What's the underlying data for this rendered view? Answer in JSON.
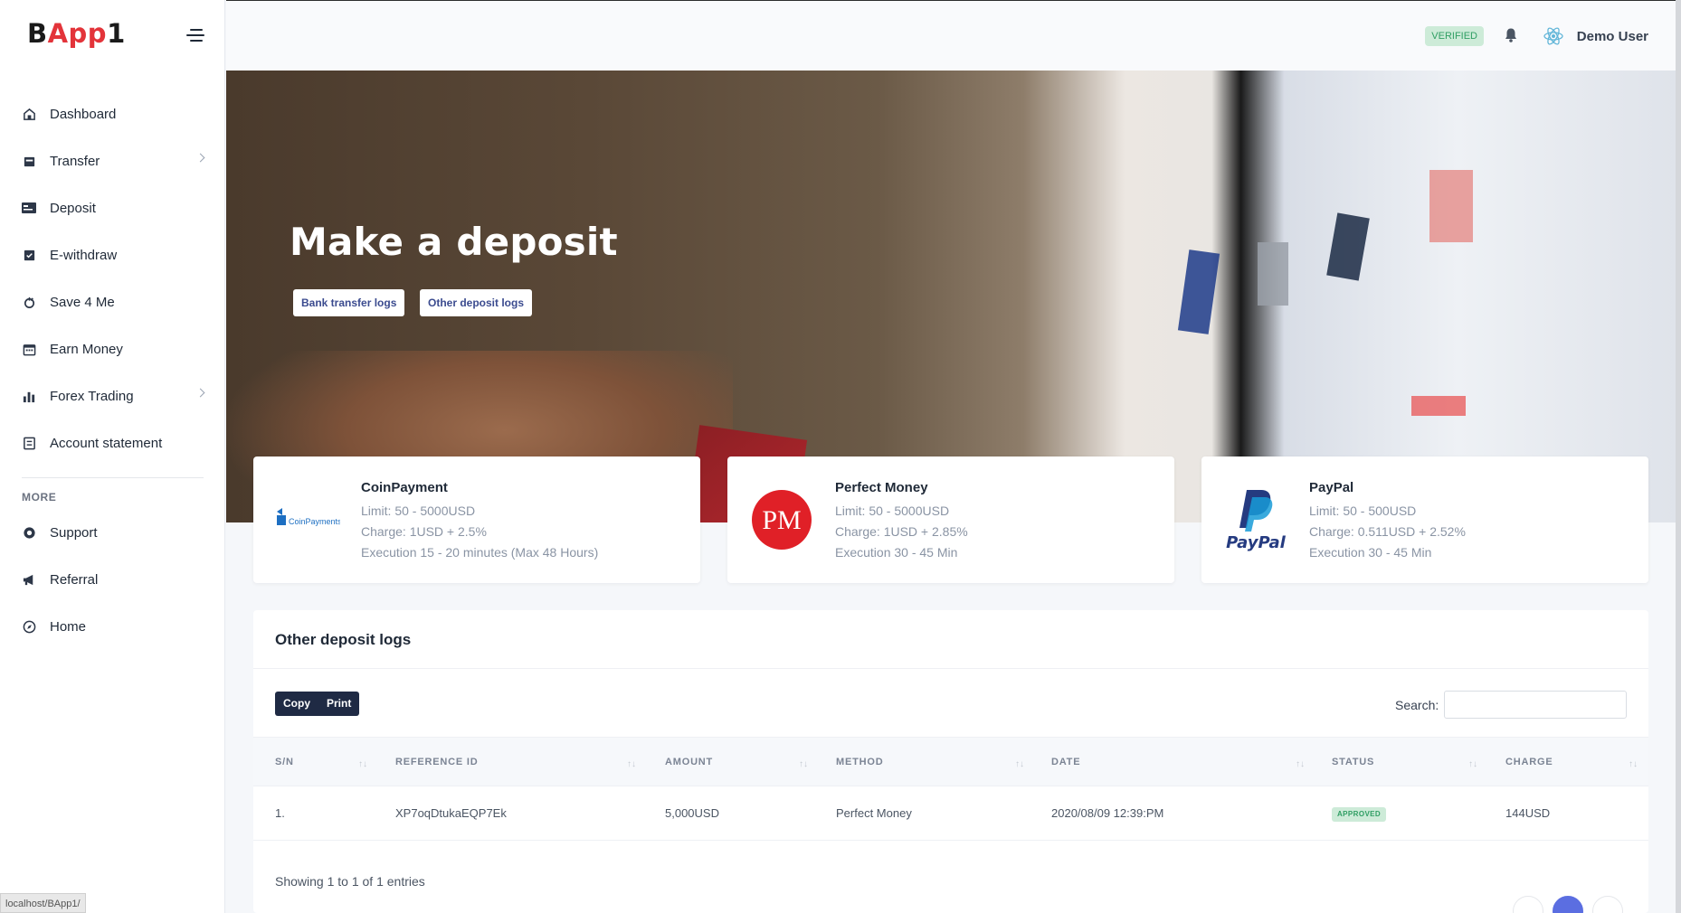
{
  "brand": {
    "part1": "B",
    "part2": "App",
    "part3": "1"
  },
  "sidebar": {
    "items": [
      {
        "label": "Dashboard",
        "icon": "home-icon",
        "chevron": false
      },
      {
        "label": "Transfer",
        "icon": "transfer-icon",
        "chevron": true
      },
      {
        "label": "Deposit",
        "icon": "deposit-icon",
        "chevron": false
      },
      {
        "label": "E-withdraw",
        "icon": "withdraw-icon",
        "chevron": false
      },
      {
        "label": "Save 4 Me",
        "icon": "savings-icon",
        "chevron": false
      },
      {
        "label": "Earn Money",
        "icon": "calendar-icon",
        "chevron": false
      },
      {
        "label": "Forex Trading",
        "icon": "chart-icon",
        "chevron": true
      },
      {
        "label": "Account statement",
        "icon": "statement-icon",
        "chevron": false
      }
    ],
    "more_heading": "MORE",
    "more_items": [
      {
        "label": "Support",
        "icon": "support-icon"
      },
      {
        "label": "Referral",
        "icon": "megaphone-icon"
      },
      {
        "label": "Home",
        "icon": "compass-icon"
      }
    ]
  },
  "topbar": {
    "verified": "VERIFIED",
    "user_name": "Demo User"
  },
  "hero": {
    "title": "Make a deposit",
    "buttons": [
      "Bank transfer logs",
      "Other deposit logs"
    ]
  },
  "gateways": [
    {
      "name": "CoinPayment",
      "logo_text": "CoinPayments",
      "limit": "Limit: 50 - 5000USD",
      "charge": "Charge: 1USD + 2.5%",
      "execution": "Execution 15 - 20 minutes (Max 48 Hours)"
    },
    {
      "name": "Perfect Money",
      "logo_text": "PM",
      "limit": "Limit: 50 - 5000USD",
      "charge": "Charge: 1USD + 2.85%",
      "execution": "Execution 30 - 45 Min"
    },
    {
      "name": "PayPal",
      "logo_text": "PayPal",
      "limit": "Limit: 50 - 500USD",
      "charge": "Charge: 0.511USD + 2.52%",
      "execution": "Execution 30 - 45 Min"
    }
  ],
  "logs": {
    "title": "Other deposit logs",
    "buttons": {
      "copy": "Copy",
      "print": "Print"
    },
    "search_label": "Search:",
    "columns": [
      "S/N",
      "REFERENCE ID",
      "AMOUNT",
      "METHOD",
      "DATE",
      "STATUS",
      "CHARGE"
    ],
    "rows": [
      {
        "sn": "1.",
        "ref": "XP7oqDtukaEQP7Ek",
        "amount": "5,000USD",
        "method": "Perfect Money",
        "date": "2020/08/09 12:39:PM",
        "status": "APPROVED",
        "charge": "144USD"
      }
    ],
    "showing": "Showing 1 to 1 of 1 entries"
  },
  "statusbar": "localhost/BApp1/",
  "colors": {
    "accent": "#5b6ee1",
    "brand_red": "#e3343a",
    "success": "#2f9e63",
    "dark_button": "#1f2a44"
  }
}
